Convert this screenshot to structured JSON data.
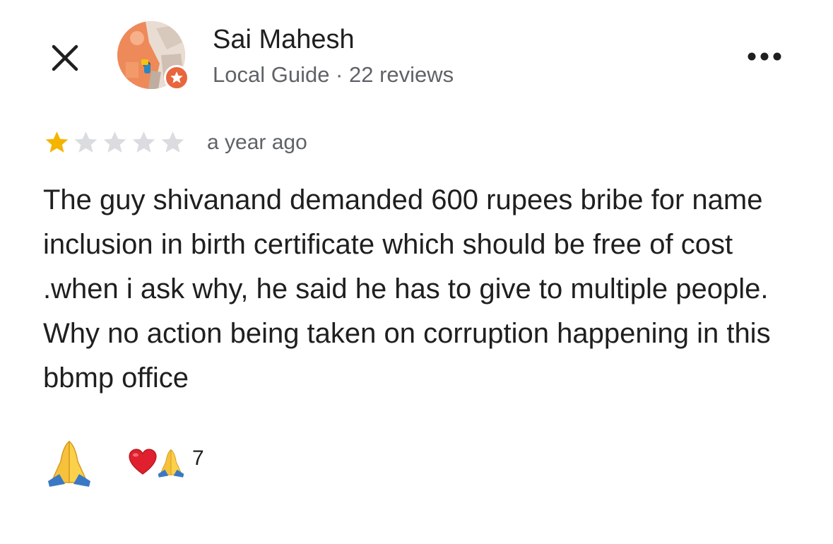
{
  "header": {
    "close_icon": "close-icon",
    "user_name": "Sai Mahesh",
    "user_meta": "Local Guide · 22 reviews",
    "avatar_icon": "avatar",
    "badge_icon": "local-guide-star-icon",
    "more_icon": "more-horizontal-icon"
  },
  "review": {
    "rating": 1,
    "max_rating": 5,
    "time": "a year ago",
    "text": "The guy shivanand demanded 600 rupees bribe for name inclusion in birth certificate which should be free of cost .when i ask why, he said he has to give to multiple people. Why no action being taken on corruption happening in this bbmp office"
  },
  "reactions": {
    "react_icon": "folded-hands-icon",
    "summary_icons": [
      "red-heart-icon",
      "folded-hands-icon"
    ],
    "count": "7"
  },
  "colors": {
    "star_filled": "#F4B400",
    "star_empty": "#DADCE0",
    "badge": "#E8663D",
    "secondary_text": "#5F6368"
  }
}
